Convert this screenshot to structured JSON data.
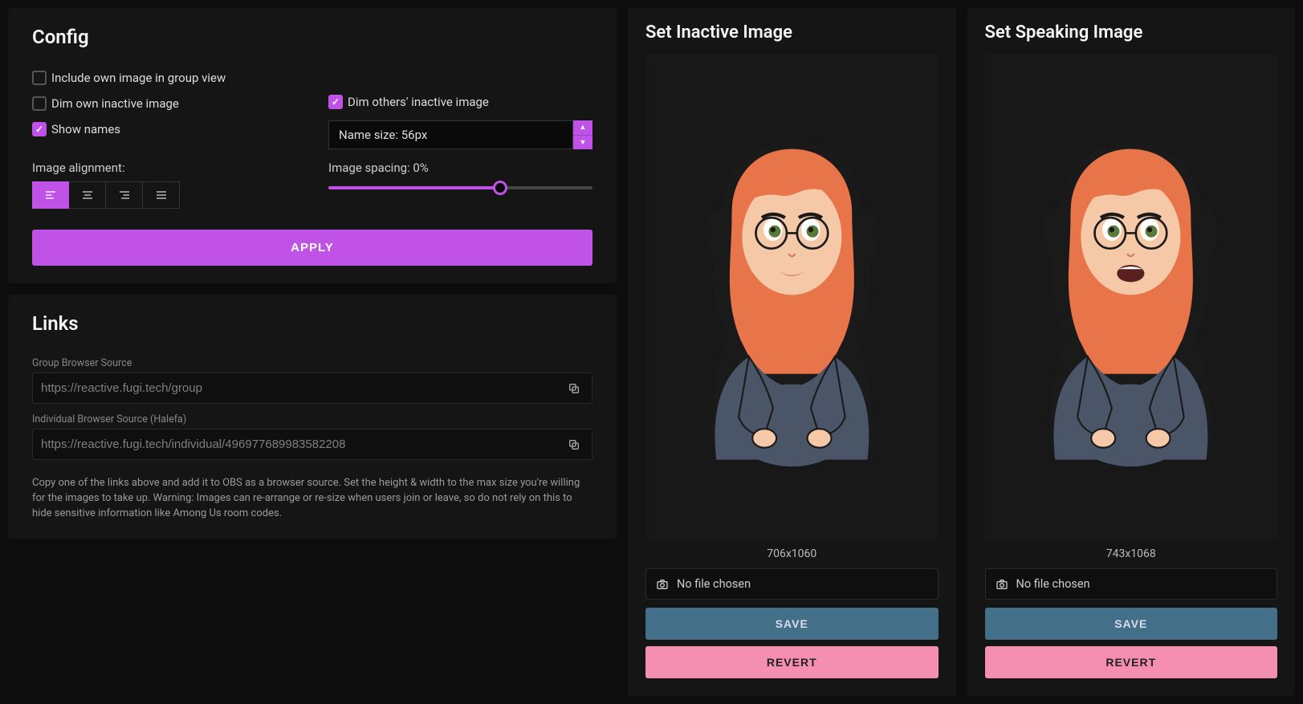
{
  "config": {
    "title": "Config",
    "include_own_label": "Include own image in group view",
    "include_own_checked": false,
    "dim_own_label": "Dim own inactive image",
    "dim_own_checked": false,
    "dim_others_label": "Dim others' inactive image",
    "dim_others_checked": true,
    "show_names_label": "Show names",
    "show_names_checked": true,
    "name_size_label": "Name size: 56px",
    "alignment_label": "Image alignment:",
    "spacing_label": "Image spacing: 0%",
    "spacing_percent": 65,
    "apply_label": "APPLY"
  },
  "links": {
    "title": "Links",
    "group_label": "Group Browser Source",
    "group_url": "https://reactive.fugi.tech/group",
    "individual_label": "Individual Browser Source (Halefa)",
    "individual_url": "https://reactive.fugi.tech/individual/496977689983582208",
    "help_text": "Copy one of the links above and add it to OBS as a browser source. Set the height & width to the max size you're willing for the images to take up. Warning: Images can re-arrange or re-size when users join or leave, so do not rely on this to hide sensitive information like Among Us room codes."
  },
  "inactive": {
    "title": "Set Inactive Image",
    "dimensions": "706x1060",
    "file_label": "No file chosen",
    "save_label": "SAVE",
    "revert_label": "REVERT"
  },
  "speaking": {
    "title": "Set Speaking Image",
    "dimensions": "743x1068",
    "file_label": "No file chosen",
    "save_label": "SAVE",
    "revert_label": "REVERT"
  }
}
